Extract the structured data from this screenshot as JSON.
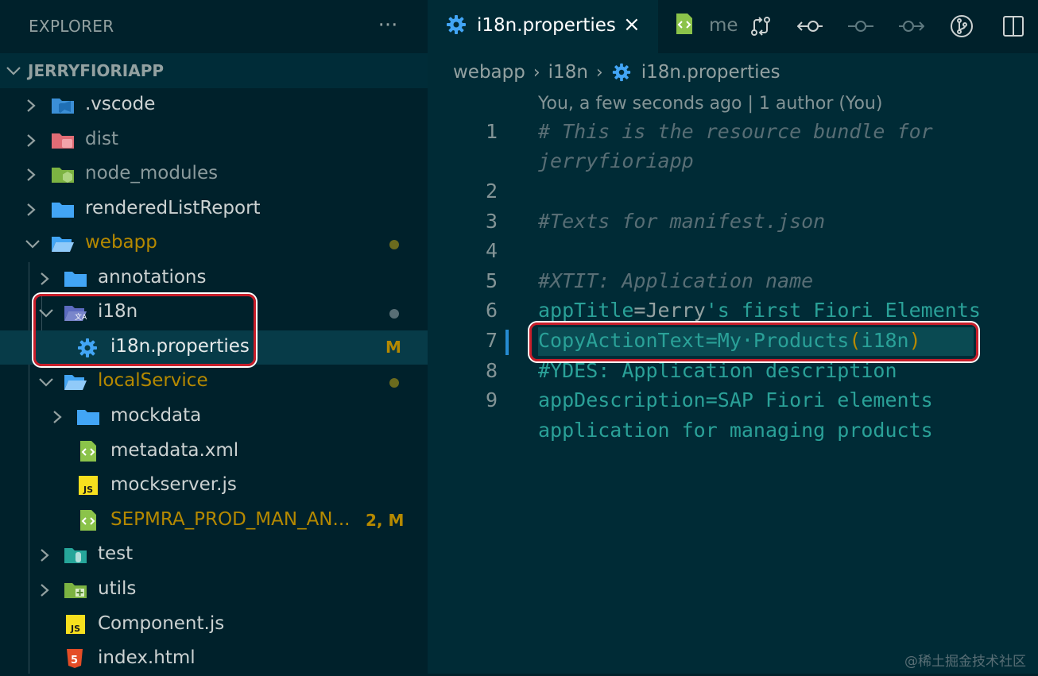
{
  "sidebar": {
    "title": "EXPLORER",
    "more_actions": "···",
    "workspace": "JERRYFIORIAPP",
    "tree": [
      {
        "label": ".vscode",
        "icon": "vscode-folder-icon"
      },
      {
        "label": "dist",
        "icon": "dist-folder-icon"
      },
      {
        "label": "node_modules",
        "icon": "node-folder-icon"
      },
      {
        "label": "renderedListReport",
        "icon": "folder-icon"
      },
      {
        "label": "webapp",
        "icon": "folder-open-icon"
      },
      {
        "label": "annotations",
        "icon": "folder-icon"
      },
      {
        "label": "i18n",
        "icon": "i18n-folder-icon"
      },
      {
        "label": "i18n.properties",
        "icon": "gear-icon",
        "badge": "M"
      },
      {
        "label": "localService",
        "icon": "folder-open-icon"
      },
      {
        "label": "mockdata",
        "icon": "folder-icon"
      },
      {
        "label": "metadata.xml",
        "icon": "xml-file-icon"
      },
      {
        "label": "mockserver.js",
        "icon": "js-file-icon"
      },
      {
        "label": "SEPMRA_PROD_MAN_AN...",
        "icon": "xml-file-icon",
        "badge": "2, M"
      },
      {
        "label": "test",
        "icon": "test-folder-icon"
      },
      {
        "label": "utils",
        "icon": "utils-folder-icon"
      },
      {
        "label": "Component.js",
        "icon": "js-file-icon"
      },
      {
        "label": "index.html",
        "icon": "html-file-icon"
      }
    ]
  },
  "editor": {
    "tabs": [
      {
        "label": "i18n.properties",
        "active": true,
        "close": "×"
      },
      {
        "label": "me",
        "active": false
      }
    ],
    "breadcrumb": [
      "webapp",
      "i18n",
      "i18n.properties"
    ],
    "breadcrumb_sep": "›",
    "codelens": "You, a few seconds ago | 1 author (You)",
    "line_numbers": [
      "1",
      "2",
      "3",
      "4",
      "5",
      "6",
      "7",
      "8",
      "9"
    ],
    "lines": {
      "l1a": "# This is the resource bundle for",
      "l1b": "jerryfioriapp",
      "l3": "#Texts for manifest.json",
      "l5": "#XTIT: Application name",
      "l6_key": "appTitle",
      "l6_eq": "=",
      "l6_val1": "Jerry",
      "l6_val2": "'s first Fiori Elements",
      "l7_text": "CopyActionText=My·Products",
      "l7_open": "(",
      "l7_inner": "i18n",
      "l7_close": ")",
      "l8": "#YDES: Application description",
      "l9a": "appDescription=SAP Fiori elements",
      "l9b": "application for managing products"
    }
  },
  "watermark": "@稀土掘金技术社区",
  "colors": {
    "background": "#002b36",
    "sidebar": "#00212b",
    "accent_teal": "#2aa198",
    "accent_yellow": "#b58900",
    "annotation_red": "#c81e2a"
  }
}
